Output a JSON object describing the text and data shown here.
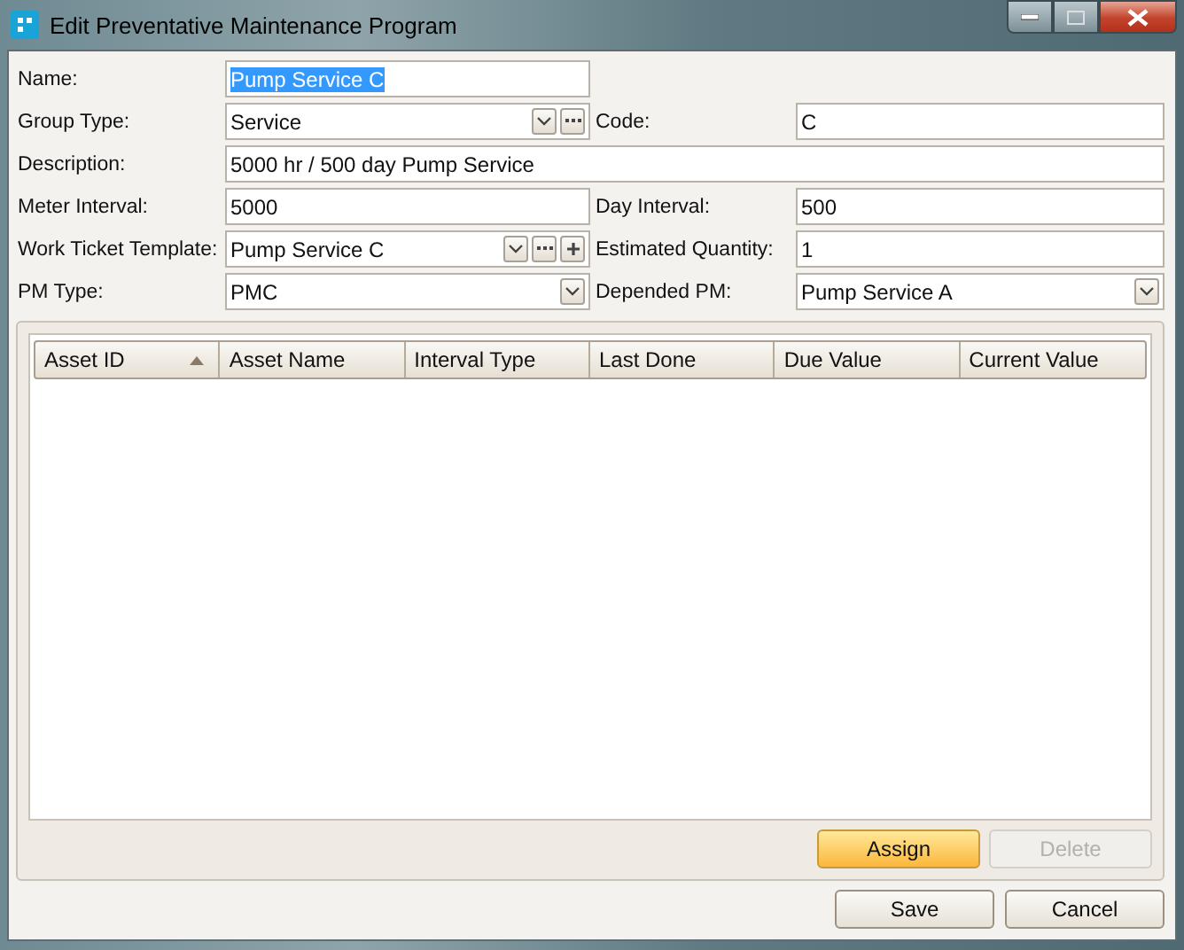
{
  "window": {
    "title": "Edit Preventative Maintenance Program"
  },
  "fields": [
    {
      "label": "Name:",
      "value": "Pump Service C",
      "kind": "text",
      "value_selected": true
    },
    {
      "kind": "blank"
    },
    {
      "label": "Group Type:",
      "value": "Service",
      "kind": "combo",
      "buttons": [
        {
          "kind": "browse"
        }
      ]
    },
    {
      "label": "Code:",
      "value": "C",
      "kind": "text"
    },
    {
      "label": "Description:",
      "value": "5000 hr / 500 day Pump Service",
      "kind": "wide"
    },
    {
      "label": "Meter Interval:",
      "value": "5000",
      "kind": "text"
    },
    {
      "label": "Day Interval:",
      "value": "500",
      "kind": "text"
    },
    {
      "label": "Work Ticket Template:",
      "value": "Pump Service C",
      "kind": "combo",
      "buttons": [
        {
          "kind": "browse"
        },
        {
          "kind": "add"
        }
      ]
    },
    {
      "label": "Estimated Quantity:",
      "value": "1",
      "kind": "text"
    },
    {
      "label": "PM Type:",
      "value": "PMC",
      "kind": "combo"
    },
    {
      "label": "Depended PM:",
      "value": "Pump Service A",
      "kind": "combo"
    }
  ],
  "table": {
    "columns": [
      {
        "label": "Asset ID",
        "sorted_ascending": true
      },
      {
        "label": "Asset Name"
      },
      {
        "label": "Interval Type"
      },
      {
        "label": "Last Done"
      },
      {
        "label": "Due Value"
      },
      {
        "label": "Current Value"
      }
    ]
  },
  "grid_buttons": [
    {
      "label": "Assign",
      "highlighted": true,
      "disabled": false
    },
    {
      "label": "Delete",
      "highlighted": false,
      "disabled": true
    }
  ],
  "buttons": [
    {
      "label": "Save"
    },
    {
      "label": "Cancel"
    }
  ]
}
